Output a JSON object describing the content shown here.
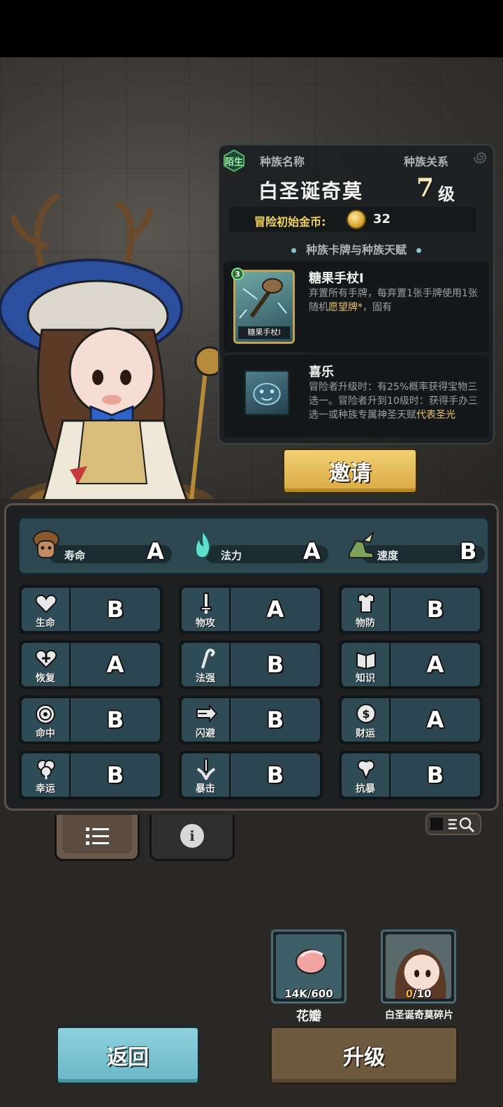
{
  "race": {
    "relation_badge": "陌生",
    "name_label": "种族名称",
    "relation_label": "种族关系",
    "name": "白圣诞奇莫",
    "level": "7",
    "level_unit": "级",
    "gold_label": "冒险初始金币:",
    "gold_value": "32",
    "section_title": "种族卡牌与种族天赋"
  },
  "card": {
    "level": "3",
    "art_name": "糖果手杖I",
    "title": "糖果手杖I",
    "desc_a": "弃置所有手牌，每弃置1张手牌使用1张随机",
    "desc_hl": "愿望牌*",
    "desc_b": "，固有"
  },
  "talent": {
    "title": "喜乐",
    "desc_a": "冒险者升级时：有25%概率获得宝物三选一。冒险者升到10级时：获得手办三选一或种族专属神圣天赋",
    "desc_hl": "代表圣光"
  },
  "invite_label": "邀请",
  "top_stats": [
    {
      "label": "寿命",
      "grade": "A",
      "icon": "mushroom-face-icon"
    },
    {
      "label": "法力",
      "grade": "A",
      "icon": "blue-flame-icon"
    },
    {
      "label": "速度",
      "grade": "B",
      "icon": "winged-boot-icon"
    }
  ],
  "stats": [
    {
      "label": "生命",
      "grade": "B",
      "icon": "heart-icon"
    },
    {
      "label": "物攻",
      "grade": "A",
      "icon": "sword-icon"
    },
    {
      "label": "物防",
      "grade": "B",
      "icon": "armor-icon"
    },
    {
      "label": "恢复",
      "grade": "A",
      "icon": "heart-plus-icon"
    },
    {
      "label": "法强",
      "grade": "B",
      "icon": "staff-icon"
    },
    {
      "label": "知识",
      "grade": "A",
      "icon": "book-icon"
    },
    {
      "label": "命中",
      "grade": "B",
      "icon": "target-icon"
    },
    {
      "label": "闪避",
      "grade": "B",
      "icon": "dash-arrow-icon"
    },
    {
      "label": "财运",
      "grade": "A",
      "icon": "coin-icon"
    },
    {
      "label": "幸运",
      "grade": "B",
      "icon": "clover-icon"
    },
    {
      "label": "暴击",
      "grade": "B",
      "icon": "crit-sword-icon"
    },
    {
      "label": "抗暴",
      "grade": "B",
      "icon": "shield-flower-icon"
    }
  ],
  "resources": [
    {
      "count_a": "14K/600",
      "count_hl": "",
      "count_b": "",
      "name": "花瓣",
      "icon": "petal-icon"
    },
    {
      "count_a": "",
      "count_hl": "0",
      "count_b": "/10",
      "name": "白圣诞奇莫碎片",
      "icon": "character-portrait-icon"
    }
  ],
  "buttons": {
    "back": "返回",
    "upgrade": "升级"
  },
  "colors": {
    "gold": "#f3d35a",
    "stat_panel": "#2e4852",
    "invite": "#f2d077",
    "back": "#8ed0dc",
    "upgrade": "#6e5a3e"
  }
}
